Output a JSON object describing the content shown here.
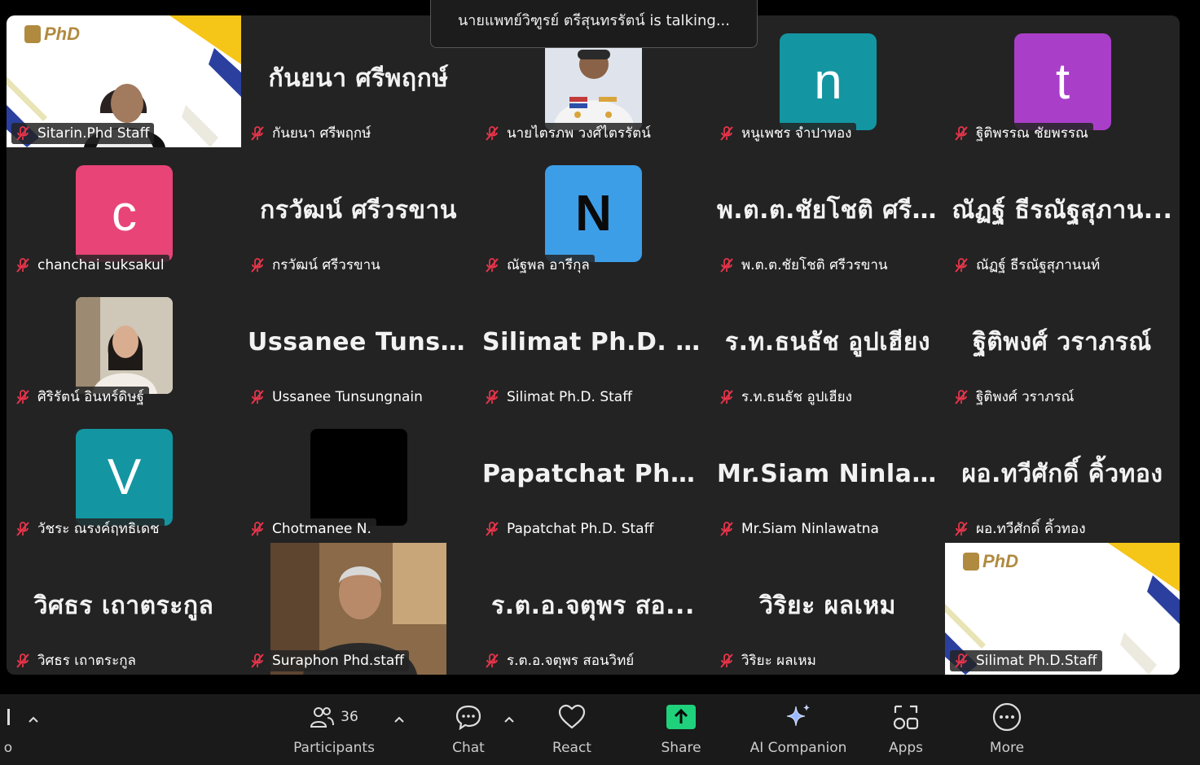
{
  "talking_banner": "นายแพทย์วิฑูรย์  ตรีสุนทรรัตน์ is talking...",
  "colors": {
    "teal": "#1396a2",
    "purple": "#a93fc9",
    "pink": "#e84477",
    "blue": "#3d9ee8",
    "share_green": "#1fd17b",
    "mute_red": "#e8344a"
  },
  "tiles": [
    {
      "label": "Sitarin.Phd Staff",
      "type": "video-logo"
    },
    {
      "label": "กันยนา ศรีพฤกษ์",
      "type": "name",
      "bigname": "กันยนา ศรีพฤกษ์"
    },
    {
      "label": "นายไตรภพ วงศ์ไตรรัตน์",
      "type": "photo"
    },
    {
      "label": "หนูเพชร จำปาทอง",
      "type": "avatar",
      "letter": "n",
      "color": "teal"
    },
    {
      "label": "ฐิติพรรณ ชัยพรรณ",
      "type": "avatar",
      "letter": "t",
      "color": "purple"
    },
    {
      "label": "chanchai suksakul",
      "type": "avatar",
      "letter": "c",
      "color": "pink"
    },
    {
      "label": "กรวัฒน์ ศรีวรขาน",
      "type": "name",
      "bigname": "กรวัฒน์ ศรีวรขาน"
    },
    {
      "label": "ณัฐพล อารีกุล",
      "type": "avatar",
      "letter": "N",
      "color": "blue",
      "dark": true
    },
    {
      "label": "พ.ต.ต.ชัยโชติ ศรีวรขาน",
      "type": "name",
      "bigname": "พ.ต.ต.ชัยโชติ ศรี..."
    },
    {
      "label": "ณัฏฐ์ ธีรณัฐสุภานนท์",
      "type": "name",
      "bigname": "ณัฏฐ์ ธีรณัฐสุภาน..."
    },
    {
      "label": "ศิริรัตน์ อินทร์ดิษฐ์",
      "type": "photo-woman"
    },
    {
      "label": "Ussanee Tunsungnain",
      "type": "name",
      "bigname": "Ussanee  Tunsun..."
    },
    {
      "label": "Silimat Ph.D. Staff",
      "type": "name",
      "bigname": "Silimat  Ph.D.  St..."
    },
    {
      "label": "ร.ท.ธนธัช  อูปเฮียง",
      "type": "name",
      "bigname": "ร.ท.ธนธัช  อูปเฮียง"
    },
    {
      "label": "ฐิติพงศ์ วราภรณ์",
      "type": "name",
      "bigname": "ฐิติพงศ์ วราภรณ์"
    },
    {
      "label": "วัชระ ณรงค์ฤทธิเดช",
      "type": "avatar",
      "letter": "V",
      "color": "teal"
    },
    {
      "label": "Chotmanee N.",
      "type": "black"
    },
    {
      "label": "Papatchat Ph.D. Staff",
      "type": "name",
      "bigname": "Papatchat  Ph.D...."
    },
    {
      "label": "Mr.Siam Ninlawatna",
      "type": "name",
      "bigname": "Mr.Siam  Ninlaw..."
    },
    {
      "label": "ผอ.ทวีศักดิ์  คิ้วทอง",
      "type": "name",
      "bigname": "ผอ.ทวีศักดิ์  คิ้วทอง"
    },
    {
      "label": "วิศธร เถาตระกูล",
      "type": "name",
      "bigname": "วิศธร เถาตระกูล"
    },
    {
      "label": "Suraphon Phd.staff",
      "type": "video-man"
    },
    {
      "label": "ร.ต.อ.จตุพร  สอนวิทย์",
      "type": "name",
      "bigname": "ร.ต.อ.จตุพร  สอ..."
    },
    {
      "label": "วิริยะ ผลเหม",
      "type": "name",
      "bigname": "วิริยะ ผลเหม"
    },
    {
      "label": "Silimat Ph.D.Staff",
      "type": "video-logo"
    }
  ],
  "logo_text": "PhD",
  "toolbar": {
    "participants_label": "Participants",
    "participants_count": "36",
    "chat_label": "Chat",
    "react_label": "React",
    "share_label": "Share",
    "ai_label": "AI Companion",
    "apps_label": "Apps",
    "more_label": "More",
    "left_partial_label": "o"
  }
}
